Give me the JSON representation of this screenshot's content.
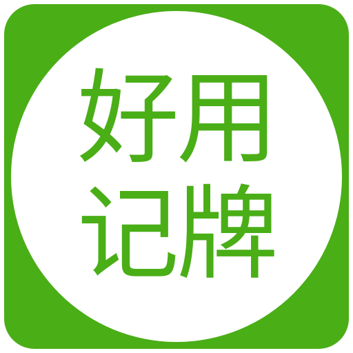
{
  "app_icon": {
    "line1": "好用",
    "line2": "记牌",
    "colors": {
      "background": "#4aae17",
      "circle": "#ffffff",
      "text": "#4aae17"
    }
  }
}
